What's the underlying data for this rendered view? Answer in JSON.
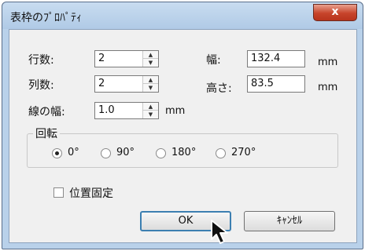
{
  "window": {
    "title": "表枠のﾌﾟﾛﾊﾟﾃｨ",
    "close_label": "x"
  },
  "fields": {
    "rows_label": "行数:",
    "rows_value": "2",
    "cols_label": "列数:",
    "cols_value": "2",
    "linewidth_label": "線の幅:",
    "linewidth_value": "1.0",
    "linewidth_unit": "mm",
    "width_label": "幅:",
    "width_value": "132.4",
    "width_unit": "mm",
    "height_label": "高さ:",
    "height_value": "83.5",
    "height_unit": "mm"
  },
  "rotation": {
    "label": "回転",
    "options": [
      "0°",
      "90°",
      "180°",
      "270°"
    ],
    "selected": "0°"
  },
  "position_lock": {
    "label": "位置固定",
    "checked": false
  },
  "buttons": {
    "ok": "OK",
    "cancel": "ｷｬﾝｾﾙ"
  },
  "icons": {
    "cursor": "mouse-pointer-icon",
    "close": "close-icon"
  }
}
